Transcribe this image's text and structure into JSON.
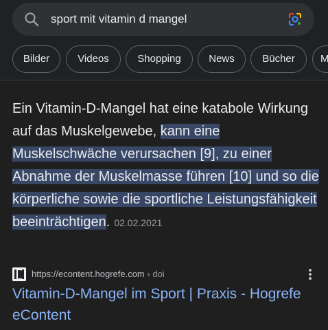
{
  "search": {
    "query": "sport mit vitamin d mangel"
  },
  "chips": [
    "Bilder",
    "Videos",
    "Shopping",
    "News",
    "Bücher",
    "M"
  ],
  "snippet": {
    "plain": "Ein Vitamin-D-Mangel hat eine katabole Wirkung auf das Muskelgewebe, ",
    "highlighted": "kann eine Muskelschwäche verursachen [9], zu einer Abnahme der Muskelmasse führen [10] und so die körperliche sowie die sportliche Leistungsfähigkeit beeinträchtigen",
    "tail": ".",
    "date": "02.02.2021"
  },
  "result": {
    "url": "https://econtent.hogrefe.com",
    "breadcrumb": " › doi",
    "title": "Vitamin-D-Mangel im Sport | Praxis - Hogrefe eContent"
  },
  "colors": {
    "background": "#1f1f1f",
    "highlight": "#384766",
    "link": "#8ab4f8"
  }
}
